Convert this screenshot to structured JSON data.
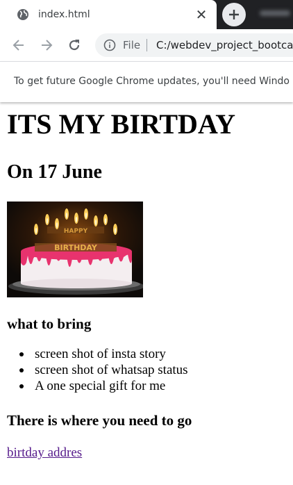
{
  "browser": {
    "tab": {
      "title": "index.html",
      "close_glyph": "✕",
      "favicon": "globe-icon"
    },
    "new_tab_glyph": "new-tab-plus-icon",
    "blurred_tab_label": "",
    "toolbar": {
      "back": "back-arrow-icon",
      "forward": "forward-arrow-icon",
      "reload": "reload-icon",
      "info_icon": "info-icon",
      "scheme": "File",
      "url": "C:/webdev_project_bootca"
    },
    "infobar": {
      "message": "To get future Google Chrome updates, you'll need Windo"
    }
  },
  "page": {
    "heading": "ITS MY BIRTDAY",
    "subheading": "On 17 June",
    "image": "birthday-cake-image",
    "bring_heading": "what to bring",
    "bring_items": [
      "screen shot of insta story",
      "screen shot of whatsap status",
      "A one special gift for me"
    ],
    "go_heading": "There is where you need to go",
    "link_text": "birtday addres"
  },
  "colors": {
    "tabstrip": "#202124",
    "omnibox": "#f1f3f4",
    "visited_link": "#551a8b",
    "cake_icing": "#e8336e"
  }
}
